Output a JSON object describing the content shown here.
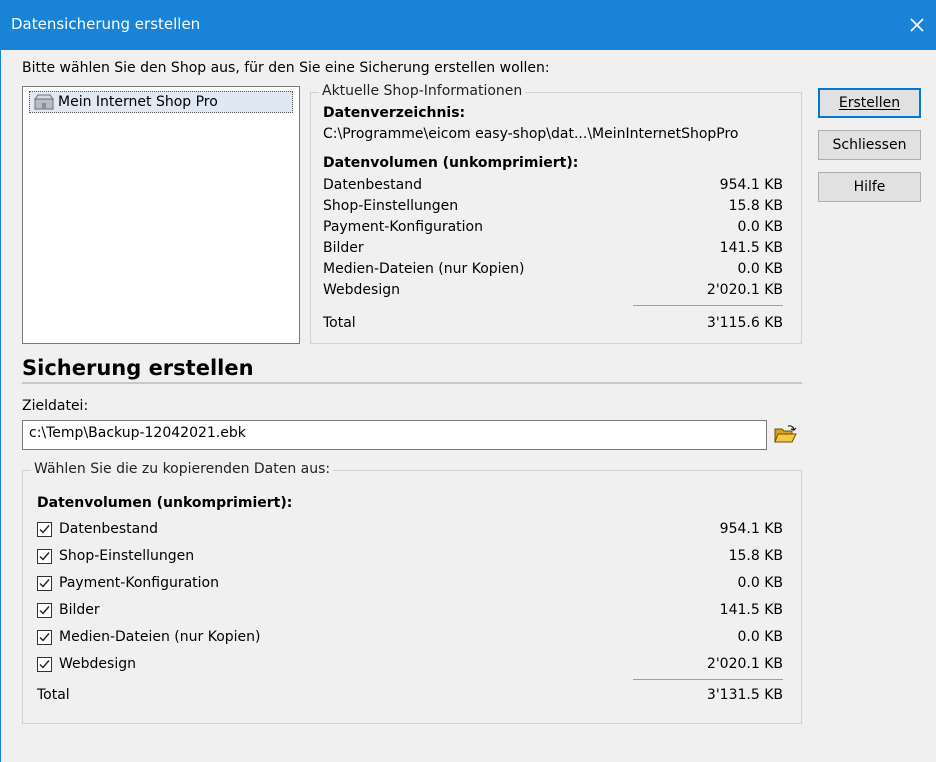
{
  "window": {
    "title": "Datensicherung erstellen",
    "close_glyph": "✕"
  },
  "prompt": "Bitte wählen Sie den Shop aus, für den Sie eine Sicherung erstellen wollen:",
  "shop_list": {
    "items": [
      {
        "label": "Mein Internet Shop Pro",
        "icon": "shop-icon"
      }
    ]
  },
  "shop_info": {
    "legend": "Aktuelle Shop-Informationen",
    "dir_heading": "Datenverzeichnis:",
    "dir_path": "C:\\Programme\\eicom easy-shop\\dat...\\MeinInternetShopPro",
    "volume_heading": "Datenvolumen (unkomprimiert):",
    "rows": [
      {
        "label": "Datenbestand",
        "value": "954.1 KB"
      },
      {
        "label": "Shop-Einstellungen",
        "value": "15.8 KB"
      },
      {
        "label": "Payment-Konfiguration",
        "value": "0.0 KB"
      },
      {
        "label": "Bilder",
        "value": "141.5 KB"
      },
      {
        "label": "Medien-Dateien (nur Kopien)",
        "value": "0.0 KB"
      },
      {
        "label": "Webdesign",
        "value": "2'020.1 KB"
      }
    ],
    "total_label": "Total",
    "total_value": "3'115.6 KB"
  },
  "buttons": {
    "create": "Erstellen",
    "close": "Schliessen",
    "help": "Hilfe"
  },
  "backup": {
    "title": "Sicherung erstellen",
    "target_label": "Zieldatei:",
    "target_value": "c:\\Temp\\Backup-12042021.ebk",
    "browse_icon": "folder-open-icon",
    "select_legend": "Wählen Sie die zu kopierenden Daten aus:",
    "volume_heading": "Datenvolumen (unkomprimiert):",
    "rows": [
      {
        "label": "Datenbestand",
        "value": "954.1 KB",
        "checked": true
      },
      {
        "label": "Shop-Einstellungen",
        "value": "15.8 KB",
        "checked": true
      },
      {
        "label": "Payment-Konfiguration",
        "value": "0.0 KB",
        "checked": true
      },
      {
        "label": "Bilder",
        "value": "141.5 KB",
        "checked": true
      },
      {
        "label": "Medien-Dateien (nur Kopien)",
        "value": "0.0 KB",
        "checked": true
      },
      {
        "label": "Webdesign",
        "value": "2'020.1 KB",
        "checked": true
      }
    ],
    "total_label": "Total",
    "total_value": "3'131.5 KB"
  },
  "colors": {
    "titlebar": "#1883d7",
    "dialog_bg": "#f0f0f0",
    "accent": "#0078d7"
  }
}
